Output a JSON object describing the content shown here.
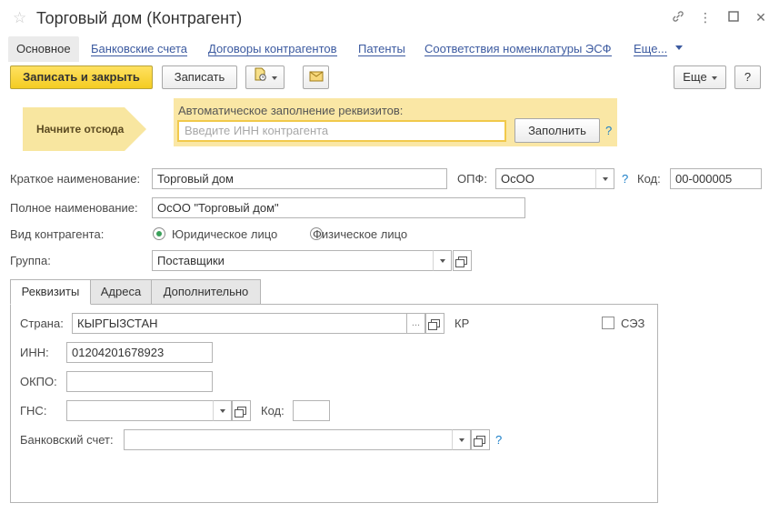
{
  "window": {
    "title": "Торговый дом (Контрагент)",
    "icons": [
      "star-icon",
      "link-icon",
      "more-icon",
      "maximize-icon",
      "close-icon"
    ]
  },
  "nav": {
    "active": "Основное",
    "links": [
      "Банковские счета",
      "Договоры контрагентов",
      "Патенты",
      "Соответствия номенклатуры ЭСФ",
      "Еще..."
    ]
  },
  "toolbar": {
    "save_close": "Записать и закрыть",
    "save": "Записать",
    "more": "Еще",
    "help": "?"
  },
  "autofill": {
    "hint": "Начните отсюда",
    "label": "Автоматическое заполнение реквизитов:",
    "placeholder": "Введите ИНН контрагента",
    "fill_button": "Заполнить",
    "help": "?"
  },
  "form": {
    "short_name_label": "Краткое наименование:",
    "short_name": "Торговый дом",
    "opf_label": "ОПФ:",
    "opf": "ОсОО",
    "opf_help": "?",
    "code_label": "Код:",
    "code": "00-000005",
    "full_name_label": "Полное наименование:",
    "full_name": "ОсОО \"Торговый дом\"",
    "type_label": "Вид контрагента:",
    "type_legal": "Юридическое лицо",
    "type_individual": "Физическое лицо",
    "type_selected": "legal",
    "group_label": "Группа:",
    "group": "Поставщики"
  },
  "tabs": {
    "items": [
      "Реквизиты",
      "Адреса",
      "Дополнительно"
    ],
    "active": "Реквизиты"
  },
  "requisites": {
    "country_label": "Страна:",
    "country": "КЫРГЫЗСТАН",
    "country_dots": "...",
    "country_code": "КР",
    "sez_label": "СЭЗ",
    "inn_label": "ИНН:",
    "inn": "01204201678923",
    "okpo_label": "ОКПО:",
    "okpo": "",
    "gns_label": "ГНС:",
    "gns": "",
    "gns_code_label": "Код:",
    "gns_code": "",
    "bank_label": "Банковский счет:",
    "bank": "",
    "bank_help": "?"
  },
  "colors": {
    "accent_yellow": "#f4cc22",
    "hint_bg": "#f8e6a0",
    "panel_bg": "#fae7a5",
    "link": "#3c5aa0",
    "help": "#1a7ec8",
    "radio_on": "#3aa05a"
  }
}
